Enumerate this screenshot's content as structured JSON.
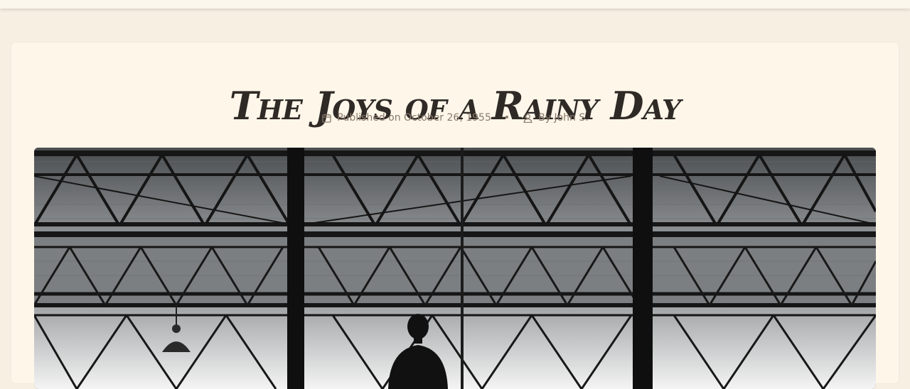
{
  "article": {
    "title": "The Joys of a Rainy Day",
    "published_label": "Published on October 26, 1955",
    "meta_separator": "•",
    "author_label": "By John S."
  },
  "icons": {
    "calendar": "calendar-icon",
    "user": "user-icon"
  },
  "hero": {
    "description": "black-and-white industrial steel truss ceiling with a silhouetted person"
  },
  "colors": {
    "page_background": "#f7efe2",
    "card_background": "#fdf6e9",
    "title": "#2f2a26",
    "meta_text": "#8a7b6c"
  }
}
